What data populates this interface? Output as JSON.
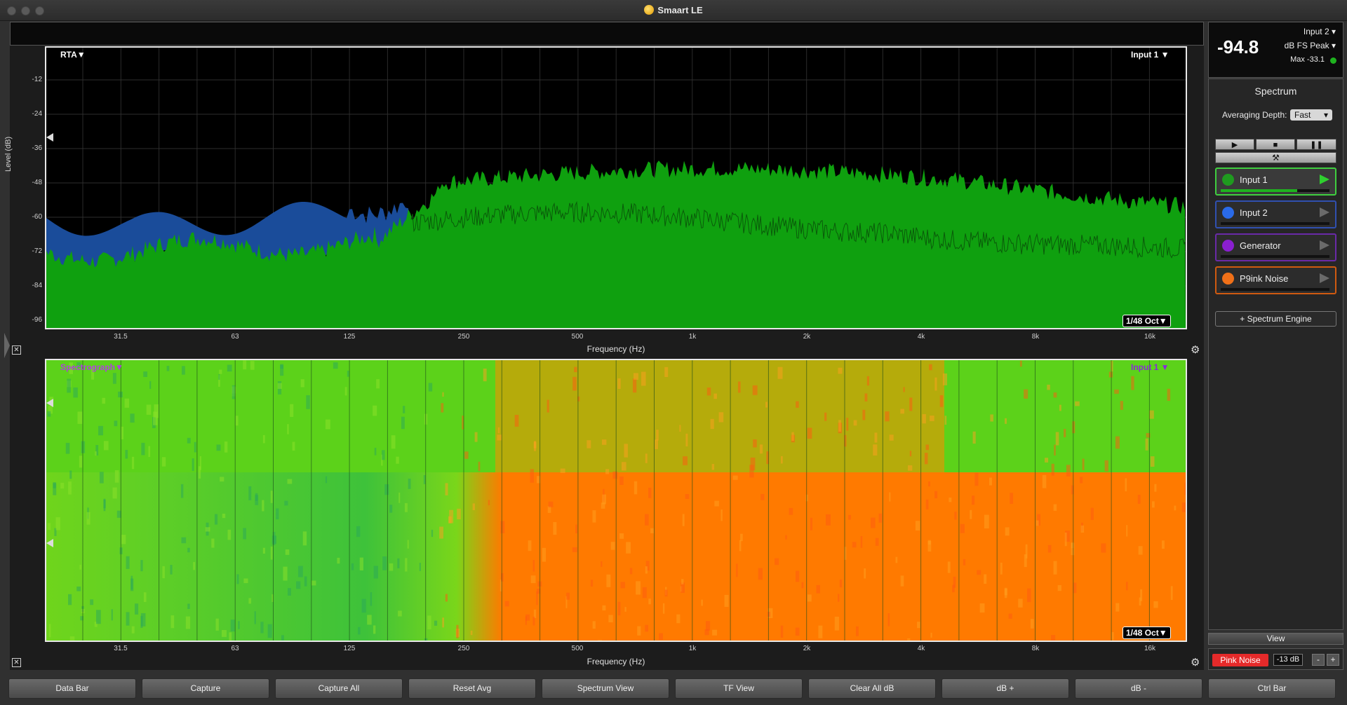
{
  "window": {
    "title": "Smaart LE"
  },
  "meter": {
    "value": "-94.8",
    "input": "Input 2",
    "unit": "dB FS Peak",
    "max": "Max -33.1"
  },
  "rta_plot": {
    "mode_label": "RTA",
    "source_label": "Input 1",
    "resolution": "1/48 Oct",
    "ylabel": "Level (dB)",
    "xlabel": "Frequency (Hz)",
    "y_ticks": [
      "-12",
      "-24",
      "-36",
      "-48",
      "-60",
      "-72",
      "-84",
      "-96"
    ],
    "x_ticks": [
      "31.5",
      "63",
      "125",
      "250",
      "500",
      "1k",
      "2k",
      "4k",
      "8k",
      "16k"
    ]
  },
  "spectrograph_plot": {
    "mode_label": "Spectrograph",
    "source_label": "Input 1",
    "resolution": "1/48 Oct",
    "xlabel": "Frequency (Hz)",
    "x_ticks": [
      "31.5",
      "63",
      "125",
      "250",
      "500",
      "1k",
      "2k",
      "4k",
      "8k",
      "16k"
    ]
  },
  "sidebar": {
    "title": "Spectrum",
    "averaging_label": "Averaging Depth:",
    "averaging_value": "Fast",
    "engines": [
      {
        "name": "Input 1",
        "color": "#1f9a1f",
        "border": "#3fcf3f",
        "level": 0.7
      },
      {
        "name": "Input 2",
        "color": "#2a6ae8",
        "border": "#3050b0",
        "level": 0.0
      },
      {
        "name": "Generator",
        "color": "#8a1fd0",
        "border": "#6a2aa8",
        "level": 0.0
      },
      {
        "name": "P9ink Noise",
        "color": "#f07018",
        "border": "#d05a10",
        "level": 0.0
      }
    ],
    "add_engine": "+ Spectrum Engine",
    "view_button": "View",
    "generator": {
      "button": "Pink Noise",
      "level": "-13 dB",
      "minus": "-",
      "plus": "+"
    }
  },
  "command_bar": [
    "Data Bar",
    "Capture",
    "Capture All",
    "Reset Avg",
    "Spectrum View",
    "TF View",
    "Clear All dB",
    "dB +",
    "dB -",
    "Ctrl Bar"
  ],
  "colors": {
    "input1_trace": "#0fa00f",
    "input2_trace": "#1a4c9a",
    "spectro_hot": "#ff7a00",
    "spectro_cool": "#5cd21a"
  }
}
